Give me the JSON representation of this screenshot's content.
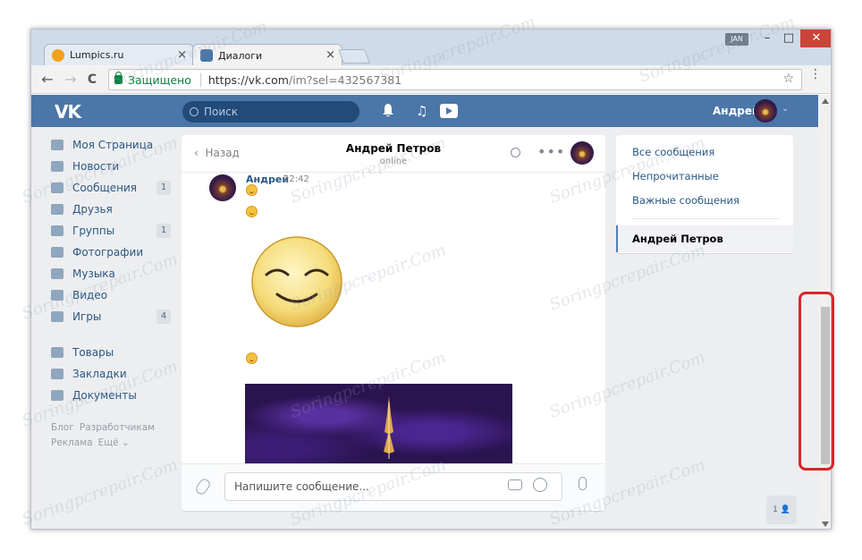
{
  "browser": {
    "tabs": [
      {
        "title": "Lumpics.ru",
        "close": "×"
      },
      {
        "title": "Диалоги",
        "close": "×"
      }
    ],
    "window_badge": "JAN",
    "controls": {
      "minimize": "–",
      "maximize": "□",
      "close": "✕"
    },
    "nav": {
      "back": "←",
      "forward": "→",
      "reload": "C"
    },
    "address": {
      "secure_label": "Защищено",
      "protocol": "https://",
      "host": "vk.com",
      "path": "/im?sel=432567381"
    },
    "star": "☆",
    "menu": "⋮"
  },
  "vk": {
    "logo": "VK",
    "search_placeholder": "Поиск",
    "user_name": "Андрей",
    "menu_chevron": "⌄",
    "left_menu": [
      {
        "label": "Моя Страница",
        "icon": "home-icon",
        "badge": ""
      },
      {
        "label": "Новости",
        "icon": "news-icon",
        "badge": ""
      },
      {
        "label": "Сообщения",
        "icon": "messages-icon",
        "badge": "1"
      },
      {
        "label": "Друзья",
        "icon": "friends-icon",
        "badge": ""
      },
      {
        "label": "Группы",
        "icon": "groups-icon",
        "badge": "1"
      },
      {
        "label": "Фотографии",
        "icon": "camera-icon",
        "badge": ""
      },
      {
        "label": "Музыка",
        "icon": "music-icon",
        "badge": ""
      },
      {
        "label": "Видео",
        "icon": "video-icon",
        "badge": ""
      },
      {
        "label": "Игры",
        "icon": "gamepad-icon",
        "badge": "4"
      }
    ],
    "left_menu_2": [
      {
        "label": "Товары",
        "icon": "bag-icon"
      },
      {
        "label": "Закладки",
        "icon": "star-icon"
      },
      {
        "label": "Документы",
        "icon": "document-icon"
      }
    ],
    "footer_links": [
      "Блог",
      "Разработчикам",
      "Реклама",
      "Ещё ⌄"
    ],
    "chat": {
      "back": "Назад",
      "name": "Андрей Петров",
      "status": "online",
      "more": "•••",
      "message": {
        "author": "Андрей",
        "time": "22:42"
      },
      "input_placeholder": "Напишите сообщение..."
    },
    "right_nav": {
      "items": [
        "Все сообщения",
        "Непрочитанные",
        "Важные сообщения"
      ],
      "active": "Андрей Петров"
    },
    "unread_count": "1"
  },
  "watermark": "Soringpcrepair.Com",
  "colors": {
    "vk_blue": "#4a76a8",
    "link": "#2a5885",
    "highlight": "#d8262a"
  }
}
